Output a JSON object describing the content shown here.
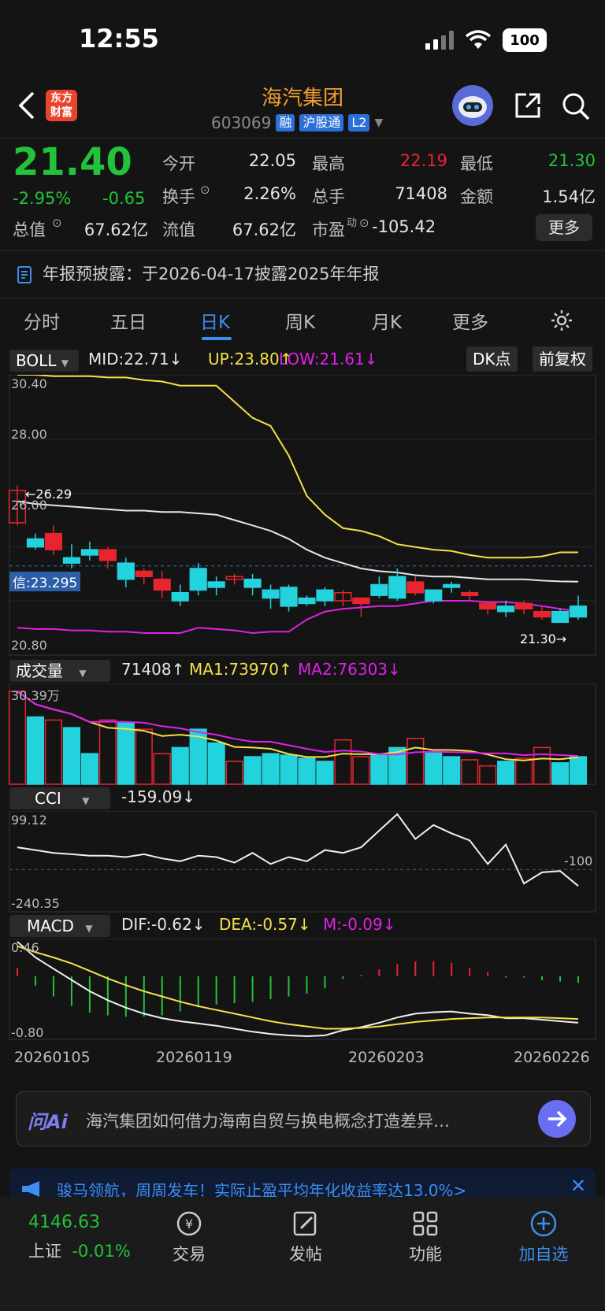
{
  "status": {
    "time": "12:55",
    "battery": "100"
  },
  "header": {
    "back_icon": "chevron-left-icon",
    "logo_text_1": "东方",
    "logo_text_2": "财富",
    "title": "海汽集团",
    "code": "603069",
    "tags": [
      "融",
      "沪股通",
      "L2"
    ]
  },
  "quote": {
    "price": "21.40",
    "change_pct": "-2.95%",
    "change": "-0.65",
    "open_label": "今开",
    "open": "22.05",
    "high_label": "最高",
    "high": "22.19",
    "low_label": "最低",
    "low": "21.30",
    "turnover_label": "换手",
    "turnover": "2.26%",
    "volume_label": "总手",
    "volume": "71408",
    "amount_label": "金额",
    "amount": "1.54亿",
    "mktcap_label": "总值",
    "mktcap": "67.62亿",
    "float_label": "流值",
    "float": "67.62亿",
    "pe_label": "市盈",
    "pe_sup": "动",
    "pe": "-105.42",
    "more": "更多"
  },
  "notice": "年报预披露：于2026-04-17披露2025年年报",
  "tabs": [
    "分时",
    "五日",
    "日K",
    "周K",
    "月K",
    "更多"
  ],
  "active_tab": "日K",
  "boll": {
    "name": "BOLL",
    "mid": "MID:22.71",
    "up": "UP:23.80",
    "low": "LOW:21.61",
    "dk": "DK点",
    "adjust": "前复权",
    "y_top": "30.40",
    "y_28": "28.00",
    "y_26": "26.00",
    "y_bottom": "20.80",
    "max_marker": "←26.29",
    "min_marker": "21.30→",
    "crosshair_price": "信:23.295"
  },
  "volume": {
    "name": "成交量",
    "value": "71408",
    "ma1": "MA1:73970",
    "ma2": "MA2:76303",
    "top": "30.39万"
  },
  "cci": {
    "name": "CCI",
    "value": "-159.09",
    "top": "99.12",
    "bottom": "-240.35",
    "ref": "-100"
  },
  "macd": {
    "name": "MACD",
    "dif": "DIF:-0.62",
    "dea": "DEA:-0.57",
    "m": "M:-0.09",
    "top": "0.46",
    "bottom": "-0.80"
  },
  "dates": [
    "20260105",
    "20260119",
    "20260203",
    "20260226"
  ],
  "chart_data": {
    "type": "candlestick",
    "open": [
      24.9,
      24.3,
      23.9,
      23.6,
      23.9,
      23.5,
      23.4,
      22.9,
      22.4,
      22.3,
      23.2,
      22.7,
      22.8,
      22.8,
      22.4,
      22.5,
      22.1,
      22.4,
      22.0,
      21.9,
      22.6,
      22.9,
      22.3,
      22.4,
      22.6,
      22.2,
      21.7,
      21.8,
      21.7,
      21.4,
      21.6,
      21.8
    ],
    "close": [
      26.1,
      24.0,
      24.5,
      23.4,
      23.7,
      23.9,
      22.8,
      23.1,
      22.8,
      22.0,
      22.4,
      22.5,
      22.9,
      22.5,
      22.1,
      21.8,
      21.9,
      22.0,
      22.3,
      22.1,
      22.2,
      22.1,
      22.7,
      22.0,
      22.5,
      22.3,
      21.9,
      21.6,
      21.9,
      21.6,
      21.2,
      21.4
    ],
    "high": [
      26.29,
      24.5,
      24.8,
      24.1,
      24.2,
      24.0,
      23.6,
      23.2,
      23.1,
      22.6,
      23.4,
      22.9,
      23.0,
      23.0,
      22.6,
      22.6,
      22.2,
      22.5,
      22.4,
      22.1,
      22.9,
      23.2,
      22.9,
      22.4,
      22.7,
      22.4,
      22.0,
      22.0,
      22.0,
      21.8,
      21.7,
      22.19
    ],
    "low": [
      24.8,
      23.9,
      23.7,
      23.2,
      23.5,
      23.2,
      22.5,
      22.6,
      22.1,
      21.8,
      22.2,
      22.2,
      22.6,
      22.2,
      21.7,
      21.6,
      21.8,
      21.8,
      21.8,
      21.4,
      22.1,
      22.0,
      22.2,
      21.9,
      22.3,
      22.0,
      21.5,
      21.4,
      21.5,
      21.3,
      21.2,
      21.3
    ],
    "boll_up": [
      30.4,
      30.4,
      30.35,
      30.35,
      30.35,
      30.3,
      30.3,
      30.2,
      30.15,
      30.0,
      30.0,
      30.0,
      29.4,
      28.8,
      28.5,
      27.4,
      25.9,
      25.2,
      24.7,
      24.6,
      24.4,
      24.1,
      24.0,
      23.9,
      23.85,
      23.7,
      23.6,
      23.6,
      23.6,
      23.65,
      23.8,
      23.8
    ],
    "boll_mid": [
      25.7,
      25.6,
      25.55,
      25.5,
      25.45,
      25.4,
      25.35,
      25.35,
      25.3,
      25.3,
      25.25,
      25.2,
      25.0,
      24.8,
      24.6,
      24.3,
      23.9,
      23.6,
      23.4,
      23.2,
      23.1,
      23.05,
      22.95,
      22.9,
      22.9,
      22.85,
      22.8,
      22.8,
      22.8,
      22.75,
      22.72,
      22.71
    ],
    "boll_low": [
      21.0,
      20.95,
      20.95,
      20.9,
      20.9,
      20.85,
      20.85,
      20.8,
      20.8,
      20.8,
      21.0,
      20.95,
      20.9,
      20.8,
      20.85,
      20.85,
      21.3,
      21.6,
      21.7,
      21.75,
      21.8,
      21.8,
      21.9,
      22.0,
      22.0,
      22.0,
      21.95,
      21.95,
      21.9,
      21.8,
      21.7,
      21.61
    ],
    "volume": [
      30.39,
      22.0,
      21.0,
      18.5,
      10.0,
      21.0,
      20.0,
      18.0,
      10.0,
      12.0,
      18.0,
      13.5,
      7.5,
      9.0,
      10.0,
      9.5,
      8.5,
      7.5,
      14.5,
      9.0,
      9.5,
      12.0,
      15.0,
      10.5,
      9.0,
      8.0,
      6.0,
      7.5,
      8.5,
      12.0,
      7.0,
      9.0
    ],
    "cci": [
      -20,
      -30,
      -40,
      -45,
      -50,
      -50,
      -55,
      -45,
      -60,
      -70,
      -50,
      -55,
      -75,
      -40,
      -80,
      -55,
      -70,
      -30,
      -40,
      -20,
      40,
      99,
      10,
      60,
      30,
      5,
      -80,
      -10,
      -150,
      -110,
      -105,
      -159
    ],
    "macd_dif": [
      0.46,
      0.25,
      0.1,
      -0.05,
      -0.2,
      -0.32,
      -0.42,
      -0.5,
      -0.56,
      -0.6,
      -0.63,
      -0.66,
      -0.7,
      -0.74,
      -0.77,
      -0.79,
      -0.8,
      -0.79,
      -0.72,
      -0.68,
      -0.62,
      -0.55,
      -0.5,
      -0.48,
      -0.47,
      -0.5,
      -0.52,
      -0.56,
      -0.56,
      -0.58,
      -0.6,
      -0.62
    ],
    "macd_dea": [
      0.4,
      0.32,
      0.25,
      0.17,
      0.07,
      -0.03,
      -0.12,
      -0.2,
      -0.27,
      -0.34,
      -0.4,
      -0.45,
      -0.5,
      -0.55,
      -0.6,
      -0.64,
      -0.67,
      -0.7,
      -0.7,
      -0.69,
      -0.67,
      -0.64,
      -0.61,
      -0.59,
      -0.57,
      -0.56,
      -0.55,
      -0.55,
      -0.55,
      -0.55,
      -0.56,
      -0.57
    ],
    "macd_hist": [
      0.06,
      -0.07,
      -0.15,
      -0.22,
      -0.27,
      -0.29,
      -0.3,
      -0.3,
      -0.29,
      -0.26,
      -0.23,
      -0.21,
      -0.2,
      -0.19,
      -0.17,
      -0.15,
      -0.13,
      -0.09,
      -0.02,
      0.01,
      0.05,
      0.09,
      0.11,
      0.11,
      0.1,
      0.06,
      0.03,
      -0.01,
      -0.01,
      -0.03,
      -0.04,
      -0.05
    ]
  },
  "ai": {
    "label": "问Ai",
    "prompt": "海汽集团如何借力海南自贸与换电概念打造差异…"
  },
  "ad": {
    "text": "骏马领航，周周发车！实际止盈平均年化收益率达13.0%>"
  },
  "bottom_nav": {
    "index_value": "4146.63",
    "index_name": "上证",
    "index_change": "-0.01%",
    "trade": "交易",
    "post": "发帖",
    "functions": "功能",
    "watchlist": "加自选"
  },
  "colors": {
    "up": "#e8252f",
    "down": "#22d3dd",
    "accent": "#3d8ef0",
    "title": "#f0a030"
  }
}
